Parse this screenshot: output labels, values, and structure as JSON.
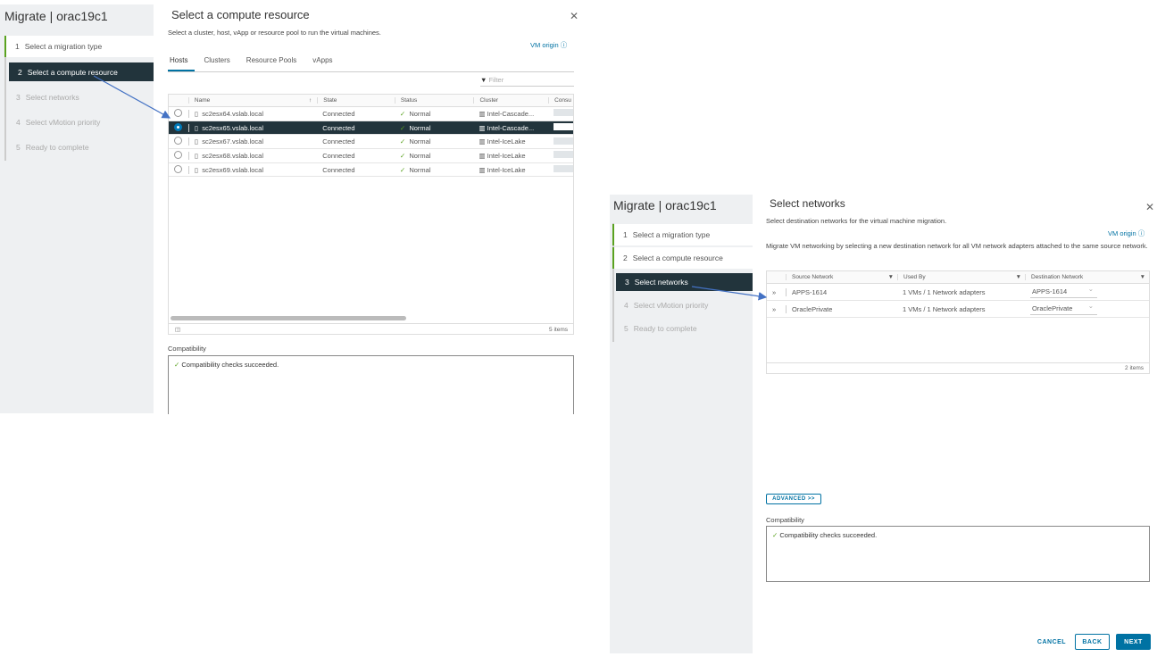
{
  "left": {
    "title": "Migrate | orac19c1",
    "steps": [
      {
        "n": "1",
        "label": "Select a migration type"
      },
      {
        "n": "2",
        "label": "Select a compute resource"
      },
      {
        "n": "3",
        "label": "Select networks"
      },
      {
        "n": "4",
        "label": "Select vMotion priority"
      },
      {
        "n": "5",
        "label": "Ready to complete"
      }
    ],
    "heading": "Select a compute resource",
    "subtitle": "Select a cluster, host, vApp or resource pool to run the virtual machines.",
    "vm_origin": "VM origin ⓘ",
    "tabs": [
      "Hosts",
      "Clusters",
      "Resource Pools",
      "vApps"
    ],
    "filter_placeholder": "Filter",
    "columns": [
      "Name",
      "State",
      "Status",
      "Cluster",
      "Consu"
    ],
    "rows": [
      {
        "name": "sc2esx64.vslab.local",
        "state": "Connected",
        "status": "Normal",
        "cluster": "Intel-Cascade..."
      },
      {
        "name": "sc2esx65.vslab.local",
        "state": "Connected",
        "status": "Normal",
        "cluster": "Intel-Cascade..."
      },
      {
        "name": "sc2esx67.vslab.local",
        "state": "Connected",
        "status": "Normal",
        "cluster": "Intel-IceLake"
      },
      {
        "name": "sc2esx68.vslab.local",
        "state": "Connected",
        "status": "Normal",
        "cluster": "Intel-IceLake"
      },
      {
        "name": "sc2esx69.vslab.local",
        "state": "Connected",
        "status": "Normal",
        "cluster": "Intel-IceLake"
      }
    ],
    "item_count": "5 items",
    "compat_label": "Compatibility",
    "compat_msg": "Compatibility checks succeeded."
  },
  "right": {
    "title": "Migrate | orac19c1",
    "heading": "Select networks",
    "subtitle": "Select destination networks for the virtual machine migration.",
    "vm_origin": "VM origin ⓘ",
    "desc": "Migrate VM networking by selecting a new destination network for all VM network adapters attached to the same source network.",
    "columns": [
      "Source Network",
      "Used By",
      "Destination Network"
    ],
    "rows": [
      {
        "source": "APPS-1614",
        "used": "1 VMs / 1 Network adapters",
        "dest": "APPS-1614"
      },
      {
        "source": "OraclePrivate",
        "used": "1 VMs / 1 Network adapters",
        "dest": "OraclePrivate"
      }
    ],
    "item_count": "2 items",
    "advanced": "ADVANCED >>",
    "compat_label": "Compatibility",
    "compat_msg": "Compatibility checks succeeded.",
    "cancel": "CANCEL",
    "back": "BACK",
    "next": "NEXT"
  }
}
